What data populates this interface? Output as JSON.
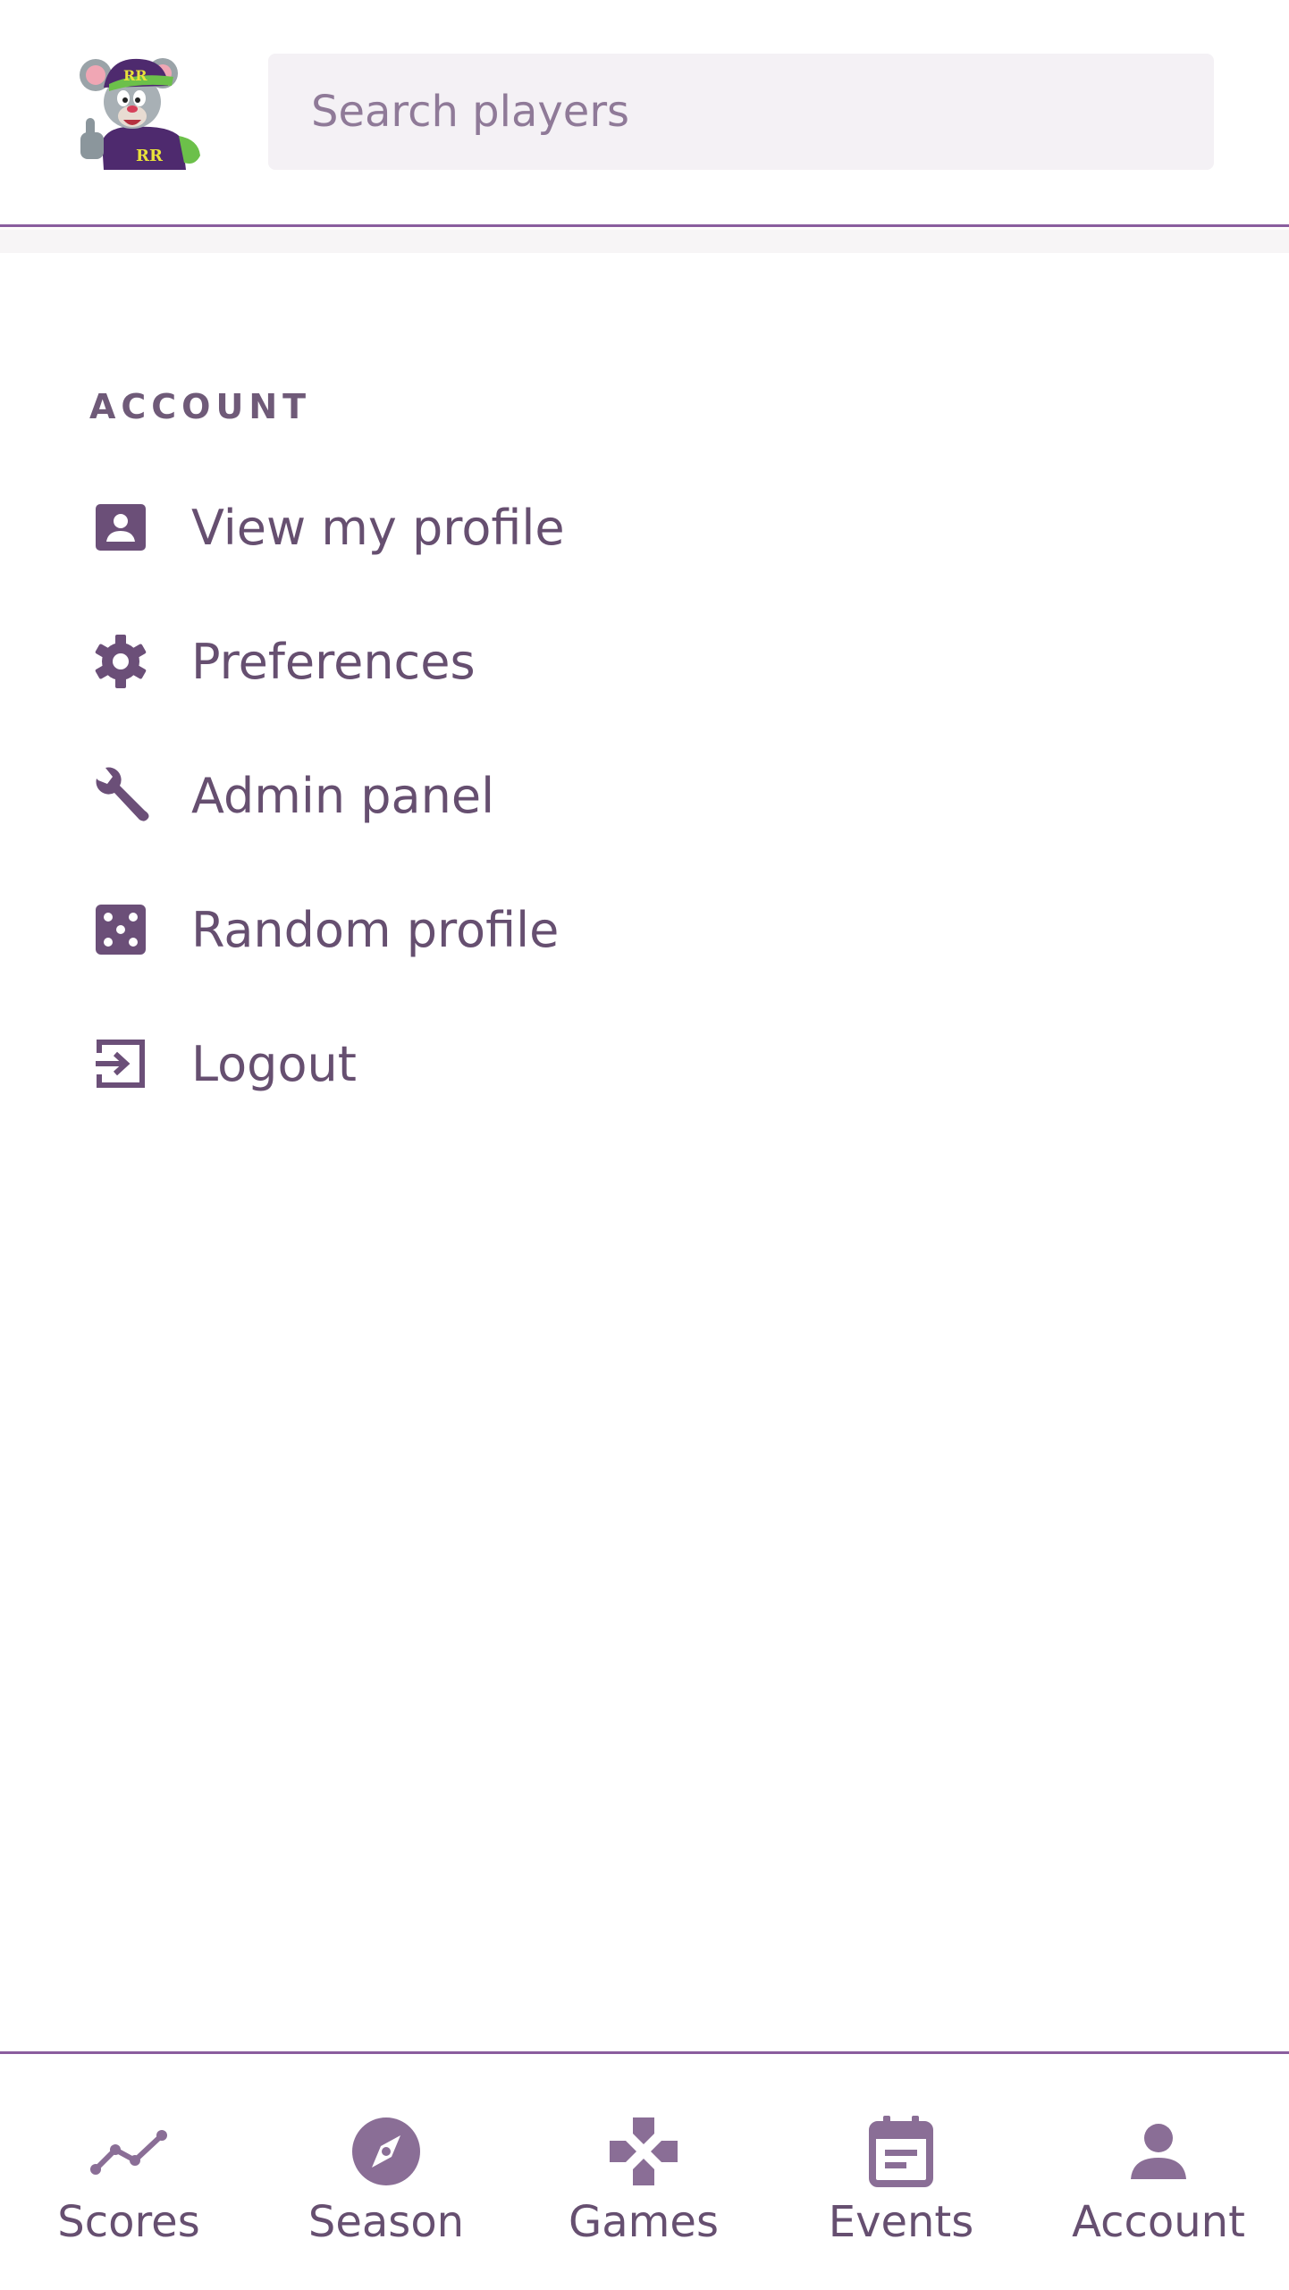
{
  "header": {
    "logo_alt": "RR mascot logo",
    "search": {
      "placeholder": "Search players",
      "value": ""
    }
  },
  "account_menu": {
    "section_title": "ACCOUNT",
    "items": [
      {
        "label": "View my profile",
        "icon": "profile-card-icon"
      },
      {
        "label": "Preferences",
        "icon": "gear-icon"
      },
      {
        "label": "Admin panel",
        "icon": "wrench-icon"
      },
      {
        "label": "Random profile",
        "icon": "dice-icon"
      },
      {
        "label": "Logout",
        "icon": "logout-icon"
      }
    ]
  },
  "bottom_nav": {
    "items": [
      {
        "label": "Scores",
        "icon": "trend-line-icon"
      },
      {
        "label": "Season",
        "icon": "compass-icon"
      },
      {
        "label": "Games",
        "icon": "dpad-icon"
      },
      {
        "label": "Events",
        "icon": "calendar-icon"
      },
      {
        "label": "Account",
        "icon": "person-icon"
      }
    ]
  },
  "colors": {
    "accent": "#8a5d9e",
    "text": "#664f70",
    "icon": "#6b4f78",
    "search_bg": "#f4f1f5"
  }
}
